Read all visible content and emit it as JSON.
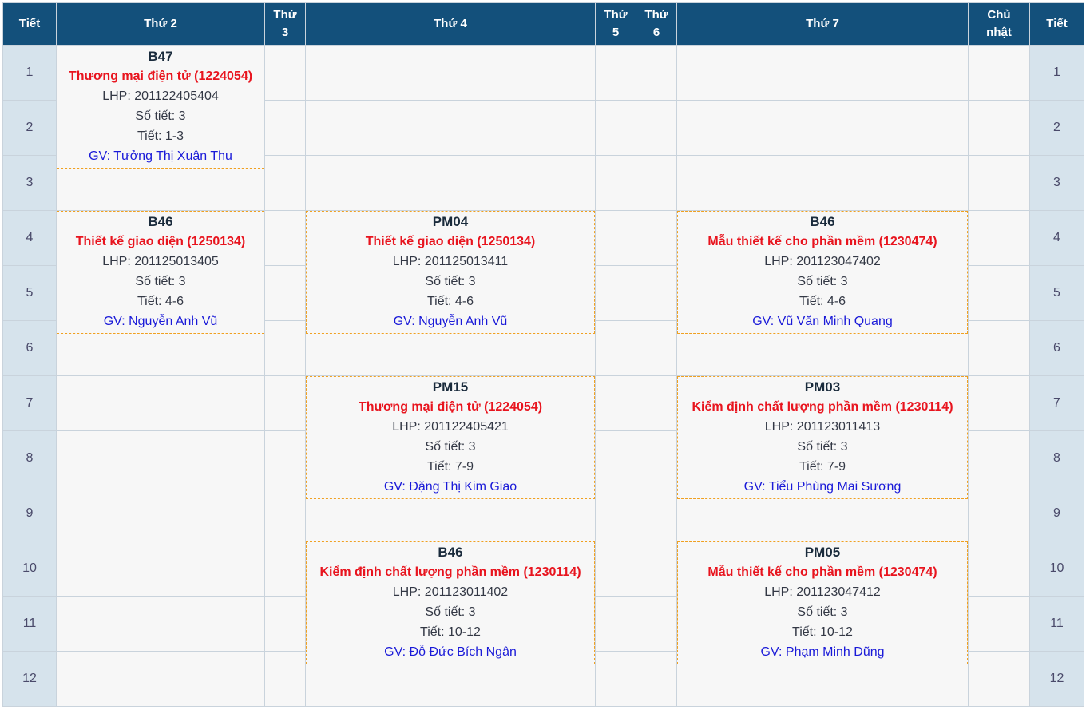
{
  "header": {
    "tiet_left": "Tiết",
    "days": [
      "Thứ 2",
      "Thứ\n3",
      "Thứ 4",
      "Thứ\n5",
      "Thứ\n6",
      "Thứ 7",
      "Chủ\nnhật"
    ],
    "tiet_right": "Tiết"
  },
  "periods": [
    "1",
    "2",
    "3",
    "4",
    "5",
    "6",
    "7",
    "8",
    "9",
    "10",
    "11",
    "12"
  ],
  "lessons": {
    "mon_1_3": {
      "room": "B47",
      "subject": "Thương mại điện tử (1224054)",
      "lhp": "LHP: 201122405404",
      "so_tiet": "Số tiết: 3",
      "tiet": "Tiết: 1-3",
      "gv": "GV: Tưởng Thị Xuân Thu"
    },
    "mon_4_6": {
      "room": "B46",
      "subject": "Thiết kế giao diện (1250134)",
      "lhp": "LHP: 201125013405",
      "so_tiet": "Số tiết: 3",
      "tiet": "Tiết: 4-6",
      "gv": "GV: Nguyễn Anh Vũ"
    },
    "wed_4_6": {
      "room": "PM04",
      "subject": "Thiết kế giao diện (1250134)",
      "lhp": "LHP: 201125013411",
      "so_tiet": "Số tiết: 3",
      "tiet": "Tiết: 4-6",
      "gv": "GV: Nguyễn Anh Vũ"
    },
    "wed_7_9": {
      "room": "PM15",
      "subject": "Thương mại điện tử (1224054)",
      "lhp": "LHP: 201122405421",
      "so_tiet": "Số tiết: 3",
      "tiet": "Tiết: 7-9",
      "gv": "GV: Đặng Thị Kim Giao"
    },
    "wed_10_12": {
      "room": "B46",
      "subject": "Kiểm định chất lượng phần mềm (1230114)",
      "lhp": "LHP: 201123011402",
      "so_tiet": "Số tiết: 3",
      "tiet": "Tiết: 10-12",
      "gv": "GV: Đỗ Đức Bích Ngân"
    },
    "sat_4_6": {
      "room": "B46",
      "subject": "Mẫu thiết kế cho phần mềm (1230474)",
      "lhp": "LHP: 201123047402",
      "so_tiet": "Số tiết: 3",
      "tiet": "Tiết: 4-6",
      "gv": "GV: Vũ Văn Minh Quang"
    },
    "sat_7_9": {
      "room": "PM03",
      "subject": "Kiểm định chất lượng phần mềm (1230114)",
      "lhp": "LHP: 201123011413",
      "so_tiet": "Số tiết: 3",
      "tiet": "Tiết: 7-9",
      "gv": "GV: Tiểu Phùng Mai Sương"
    },
    "sat_10_12": {
      "room": "PM05",
      "subject": "Mẫu thiết kế cho phần mềm (1230474)",
      "lhp": "LHP: 201123047412",
      "so_tiet": "Số tiết: 3",
      "tiet": "Tiết: 10-12",
      "gv": "GV: Phạm Minh Dũng"
    }
  }
}
